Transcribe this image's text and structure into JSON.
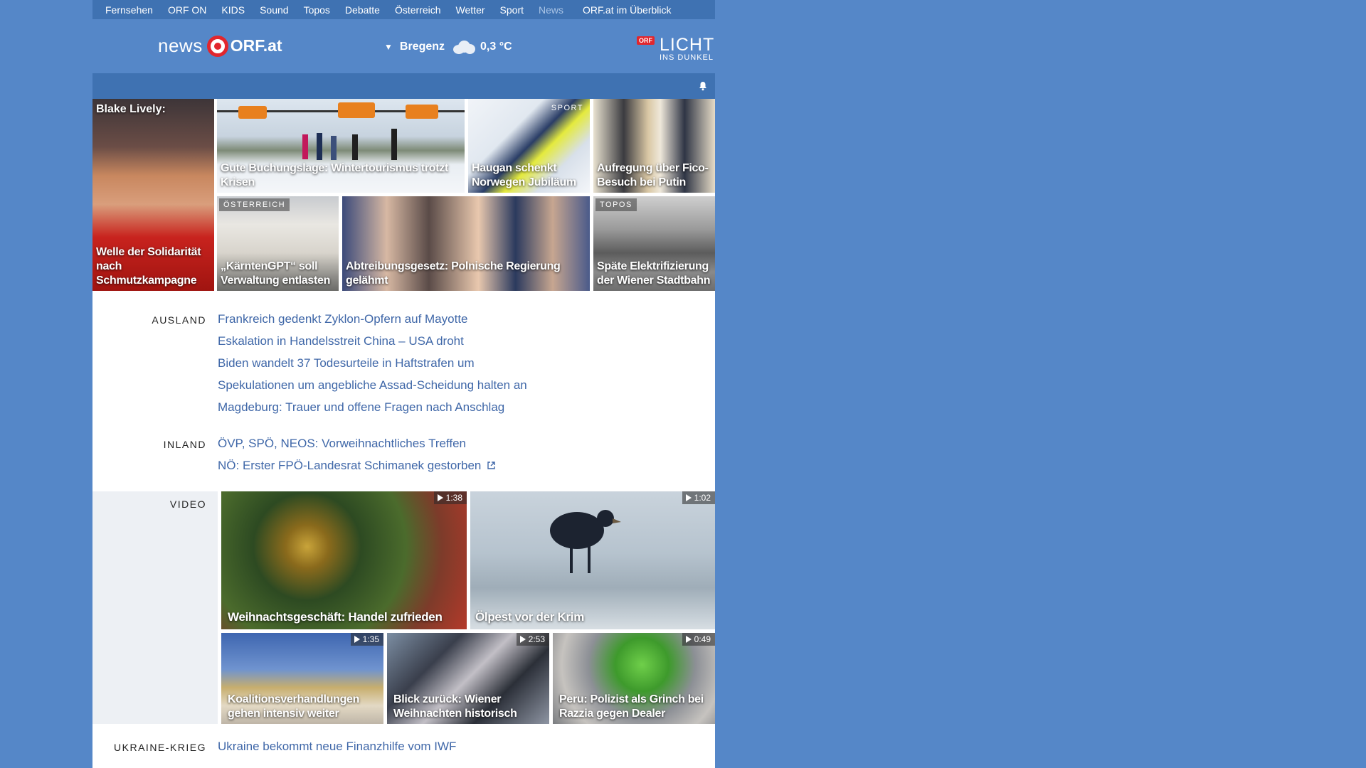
{
  "nav": {
    "items": [
      "Fernsehen",
      "ORF ON",
      "KIDS",
      "Sound",
      "Topos",
      "Debatte",
      "Österreich",
      "Wetter",
      "Sport",
      "News"
    ],
    "overview": "ORF.at im Überblick"
  },
  "header": {
    "logo_news": "news",
    "logo_orfat": "ORF.at",
    "weather_city": "Bregenz",
    "weather_temp": "0,3 °C",
    "weather_icon": "cloud-icon",
    "licht_badge": "ORF",
    "licht_big": "LICHT",
    "licht_small": "INS DUNKEL"
  },
  "teasers": {
    "blake_top": "Blake Lively:",
    "blake": "Welle der Solidarität nach Schmutzkampagne",
    "ski": "Gute Buchungslage: Wintertourismus trotzt Krisen",
    "sport_tag": "SPORT",
    "haugan": "Haugan schenkt Norwegen Jubiläum",
    "fico": "Aufregung über Fico-Besuch bei Putin",
    "oesterreich_tag": "ÖSTERREICH",
    "kaernten": "„KärntenGPT“ soll Verwaltung entlasten",
    "abtreibung": "Abtreibungsgesetz: Polnische Regierung gelähmt",
    "topos_tag": "TOPOS",
    "stadtbahn": "Späte Elektrifizierung der Wiener Stadtbahn"
  },
  "ausland": {
    "label": "AUSLAND",
    "links": [
      "Frankreich gedenkt Zyklon-Opfern auf Mayotte",
      "Eskalation in Handelsstreit China – USA droht",
      "Biden wandelt 37 Todesurteile in Haftstrafen um",
      "Spekulationen um angebliche Assad-Scheidung halten an",
      "Magdeburg: Trauer und offene Fragen nach Anschlag"
    ]
  },
  "inland": {
    "label": "INLAND",
    "links": [
      "ÖVP, SPÖ, NEOS: Vorweihnachtliches Treffen",
      "NÖ: Erster FPÖ-Landesrat Schimanek gestorben"
    ]
  },
  "video": {
    "label": "VIDEO",
    "items": [
      {
        "title": "Weihnachtsgeschäft: Handel zufrieden",
        "duration": "1:38"
      },
      {
        "title": "Ölpest vor der Krim",
        "duration": "1:02"
      },
      {
        "title": "Koalitionsverhandlungen gehen intensiv weiter",
        "duration": "1:35"
      },
      {
        "title": "Blick zurück: Wiener Weihnachten historisch",
        "duration": "2:53"
      },
      {
        "title": "Peru: Polizist als Grinch bei Razzia gegen Dealer",
        "duration": "0:49"
      }
    ]
  },
  "ukraine": {
    "label": "UKRAINE-KRIEG",
    "links": [
      "Ukraine bekommt neue Finanzhilfe vom IWF"
    ]
  },
  "colors": {
    "background": "#5587c8",
    "nav_bar": "#3f72b2",
    "link": "#3f67a8",
    "orf_red": "#e2262d"
  }
}
